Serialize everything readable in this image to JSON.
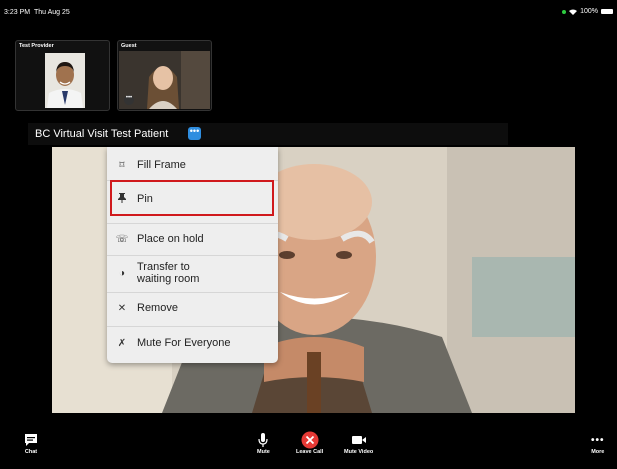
{
  "status_bar": {
    "time": "3:23 PM",
    "date": "Thu Aug 25",
    "battery": "100%"
  },
  "participants": [
    {
      "label": "Test Provider"
    },
    {
      "label": "Guest",
      "more": "•••"
    }
  ],
  "main": {
    "patient_name": "BC Virtual Visit Test Patient",
    "menu_button": "•••"
  },
  "menu": {
    "items": [
      {
        "label": "Fill Frame",
        "icon": "fill-frame-icon"
      },
      {
        "label": "Pin",
        "icon": "pin-icon"
      },
      {
        "label": "Place on hold",
        "icon": "hold-icon"
      },
      {
        "label": "Transfer to waiting room",
        "line1": "Transfer to",
        "line2": "waiting room",
        "icon": "transfer-icon"
      },
      {
        "label": "Remove",
        "icon": "close-icon"
      },
      {
        "label": "Mute For Everyone",
        "icon": "mute-everyone-icon"
      }
    ],
    "highlighted": "Pin"
  },
  "toolbar": {
    "chat": "Chat",
    "mute": "Mute",
    "leave": "Leave Call",
    "mute_video": "Mute Video",
    "more": "More"
  },
  "colors": {
    "accent": "#2f8ee0",
    "leave": "#e53935",
    "highlight": "#d0191c"
  }
}
